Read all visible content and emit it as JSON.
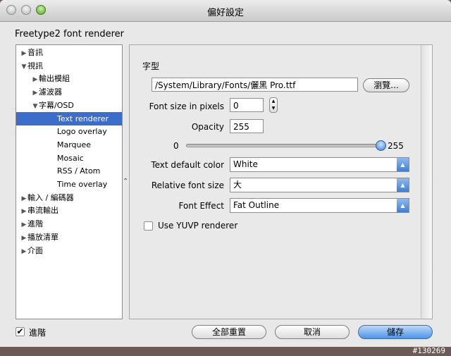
{
  "window": {
    "title": "偏好設定"
  },
  "section_title": "Freetype2 font renderer",
  "sidebar": {
    "items": [
      {
        "label": "音訊",
        "arrow": "▶",
        "selected": false
      },
      {
        "label": "視訊",
        "arrow": "▼",
        "selected": false
      },
      {
        "label": "輸出模組",
        "arrow": "▶",
        "selected": false
      },
      {
        "label": "濾波器",
        "arrow": "▶",
        "selected": false
      },
      {
        "label": "字幕/OSD",
        "arrow": "▼",
        "selected": false
      },
      {
        "label": "Text renderer",
        "arrow": "",
        "selected": true
      },
      {
        "label": "Logo overlay",
        "arrow": "",
        "selected": false
      },
      {
        "label": "Marquee",
        "arrow": "",
        "selected": false
      },
      {
        "label": "Mosaic",
        "arrow": "",
        "selected": false
      },
      {
        "label": "RSS / Atom",
        "arrow": "",
        "selected": false
      },
      {
        "label": "Time overlay",
        "arrow": "",
        "selected": false
      },
      {
        "label": "輸入 / 編碼器",
        "arrow": "▶",
        "selected": false
      },
      {
        "label": "串流輸出",
        "arrow": "▶",
        "selected": false
      },
      {
        "label": "進階",
        "arrow": "▶",
        "selected": false
      },
      {
        "label": "播放清單",
        "arrow": "▶",
        "selected": false
      },
      {
        "label": "介面",
        "arrow": "▶",
        "selected": false
      }
    ]
  },
  "splitter_glyph": "⌃",
  "panel": {
    "font_label": "字型",
    "font_path": "/System/Library/Fonts/儷黑 Pro.ttf",
    "browse_button": "瀏覽...",
    "font_size_label": "Font size in pixels",
    "font_size_value": "0",
    "opacity_label": "Opacity",
    "opacity_value": "255",
    "slider_min": "0",
    "slider_max": "255",
    "slider_fraction": 1.0,
    "text_color_label": "Text default color",
    "text_color_value": "White",
    "relative_size_label": "Relative font size",
    "relative_size_value": "大",
    "font_effect_label": "Font Effect",
    "font_effect_value": "Fat Outline",
    "yuvp_label": "Use YUVP renderer",
    "yuvp_checked": false
  },
  "footer": {
    "advanced_label": "進階",
    "advanced_checked": true,
    "reset_button": "全部重置",
    "cancel_button": "取消",
    "save_button": "儲存"
  },
  "watermark": "#130269"
}
